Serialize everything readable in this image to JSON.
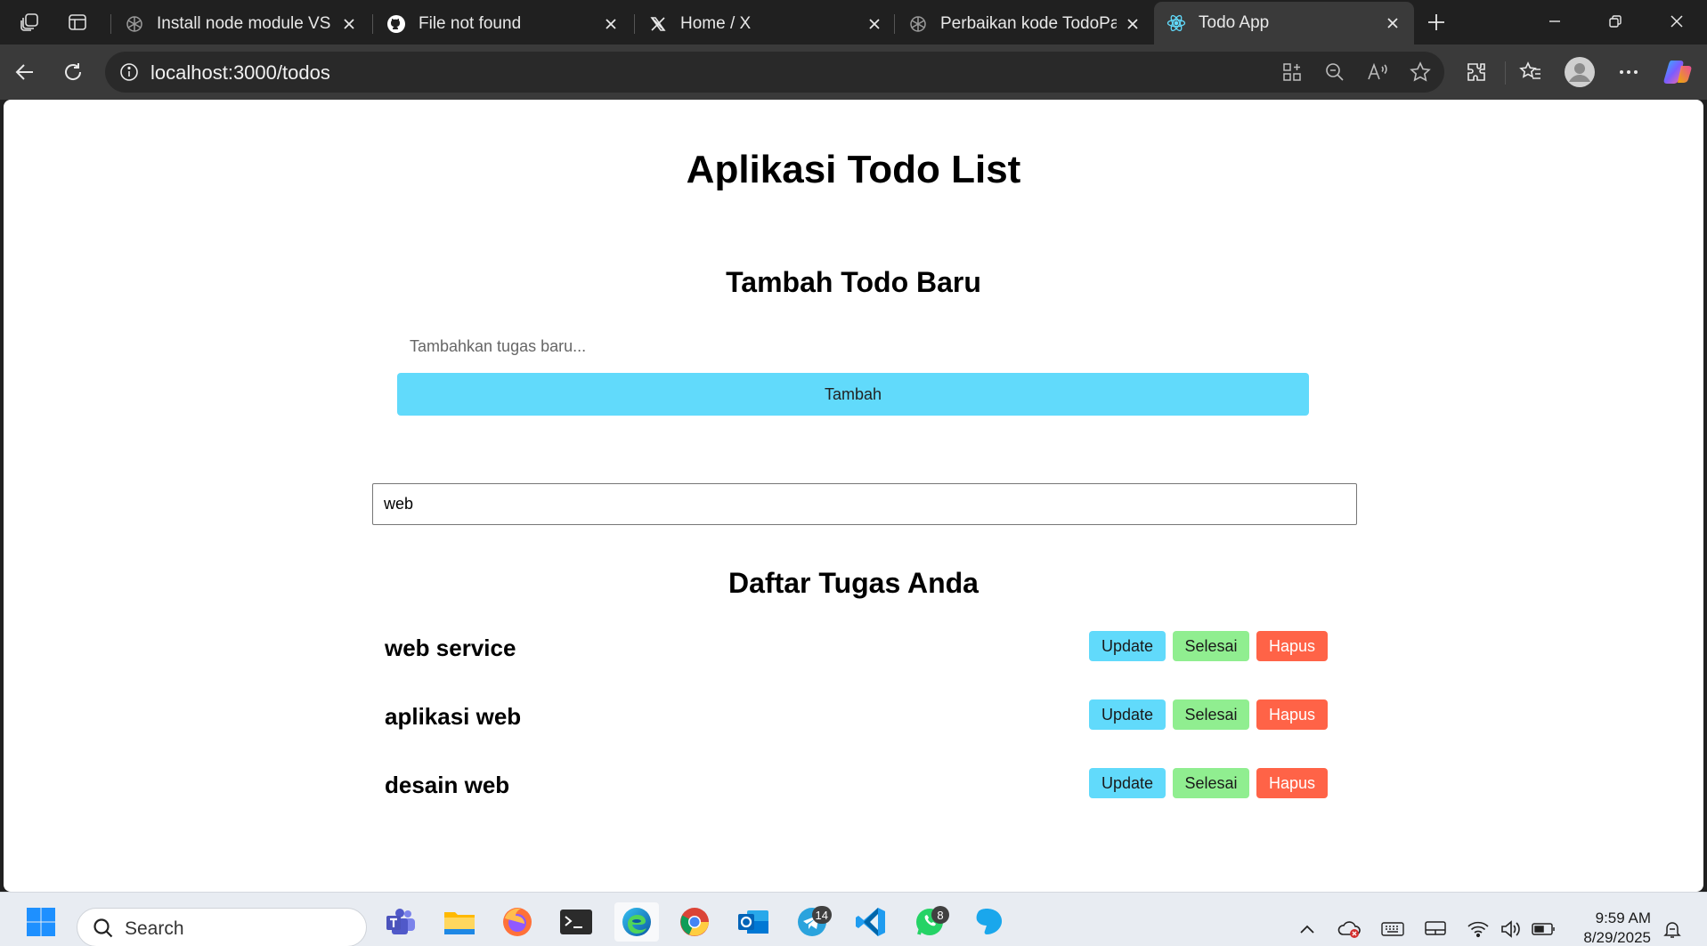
{
  "browser": {
    "tabs": [
      {
        "title": "Install node module VS C",
        "favicon": "openai-icon",
        "active": false
      },
      {
        "title": "File not found",
        "favicon": "github-icon",
        "active": false
      },
      {
        "title": "Home / X",
        "favicon": "x-icon",
        "active": false
      },
      {
        "title": "Perbaikan kode TodoPage",
        "favicon": "openai-icon",
        "active": false
      },
      {
        "title": "Todo App",
        "favicon": "react-icon",
        "active": true
      }
    ],
    "url": "localhost:3000/todos"
  },
  "app": {
    "title": "Aplikasi Todo List",
    "form_title": "Tambah Todo Baru",
    "new_todo_placeholder": "Tambahkan tugas baru...",
    "add_label": "Tambah",
    "search_value": "web",
    "list_title": "Daftar Tugas Anda",
    "todos": [
      {
        "text": "web service"
      },
      {
        "text": "aplikasi web"
      },
      {
        "text": "desain web"
      }
    ],
    "actions": {
      "update": "Update",
      "done": "Selesai",
      "delete": "Hapus"
    },
    "colors": {
      "primary": "#61dafb",
      "done": "#90ee90",
      "delete": "#ff6347"
    }
  },
  "taskbar": {
    "search_label": "Search",
    "telegram_badge": "14",
    "whatsapp_badge": "8",
    "time": "9:59 AM",
    "date": "8/29/2025"
  }
}
